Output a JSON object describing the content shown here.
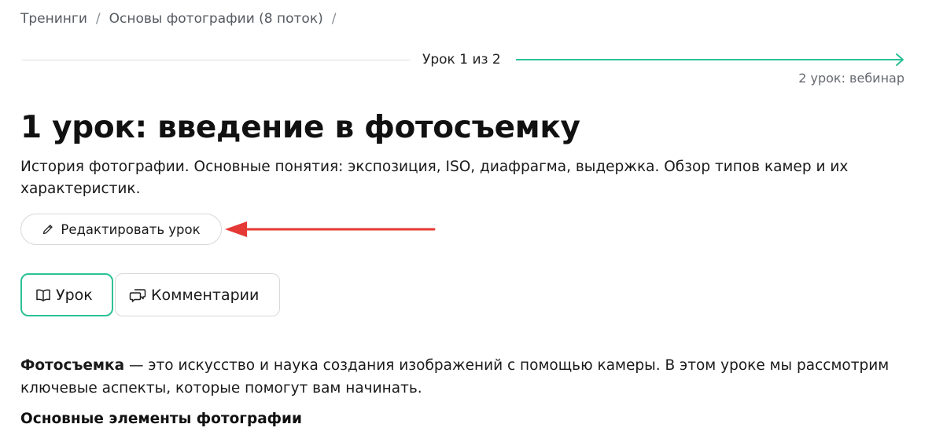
{
  "breadcrumb": {
    "items": [
      "Тренинги",
      "Основы фотографии (8 поток)"
    ],
    "separator": "/"
  },
  "progress": {
    "label": "Урок 1 из 2",
    "next_lesson": "2 урок: вебинар",
    "current": 1,
    "total": 2,
    "accent_color": "#2cc197"
  },
  "lesson": {
    "title": "1 урок: введение в фотосъемку",
    "description": "История фотографии. Основные понятия: экспозиция, ISO, диафрагма, выдержка. Обзор типов камер и их характеристик.",
    "edit_label": "Редактировать урок"
  },
  "tabs": [
    {
      "label": "Урок",
      "icon": "book-icon",
      "active": true
    },
    {
      "label": "Комментарии",
      "icon": "comments-icon",
      "active": false
    }
  ],
  "content": {
    "intro_bold": "Фотосъемка",
    "intro_text": " — это искусство и наука создания изображений с помощью камеры. В этом уроке мы рассмотрим ключевые аспекты, которые помогут вам начинать.",
    "section_heading": "Основные элементы фотографии"
  },
  "annotation": {
    "color": "#e53935"
  }
}
